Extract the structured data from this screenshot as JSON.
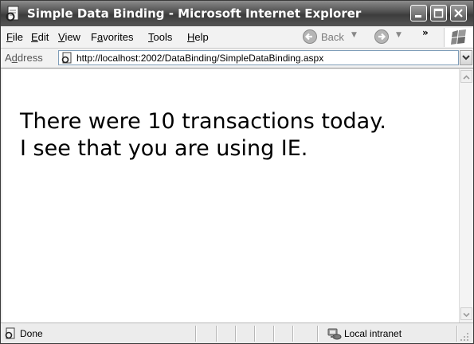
{
  "window": {
    "title": "Simple Data Binding - Microsoft Internet Explorer"
  },
  "menu": {
    "items": [
      {
        "label": "File",
        "mnemonic": "F",
        "rest": "ile"
      },
      {
        "label": "Edit",
        "mnemonic": "E",
        "rest": "dit"
      },
      {
        "label": "View",
        "mnemonic": "V",
        "rest": "iew"
      },
      {
        "label": "Favorites",
        "pre": "F",
        "mnemonic": "a",
        "rest": "vorites"
      },
      {
        "label": "Tools",
        "mnemonic": "T",
        "rest": "ools"
      },
      {
        "label": "Help",
        "mnemonic": "H",
        "rest": "elp"
      }
    ],
    "back_label": "Back",
    "overflow": "»"
  },
  "address": {
    "label": "Address",
    "label_pre": "A",
    "label_mnemonic": "d",
    "label_rest": "dress",
    "url": "http://localhost:2002/DataBinding/SimpleDataBinding.aspx"
  },
  "content": {
    "line1": "There were 10 transactions today.",
    "line2": "I see that you are using IE."
  },
  "status": {
    "text": "Done",
    "zone": "Local intranet"
  },
  "icons": {
    "app": "ie-page-icon",
    "back": "back-arrow-icon",
    "forward": "forward-arrow-icon",
    "windows_logo": "windows-flag-icon",
    "zone": "local-intranet-icon"
  },
  "colors": {
    "titlebar": "#4e4e4e",
    "address_border": "#7f9db9"
  }
}
